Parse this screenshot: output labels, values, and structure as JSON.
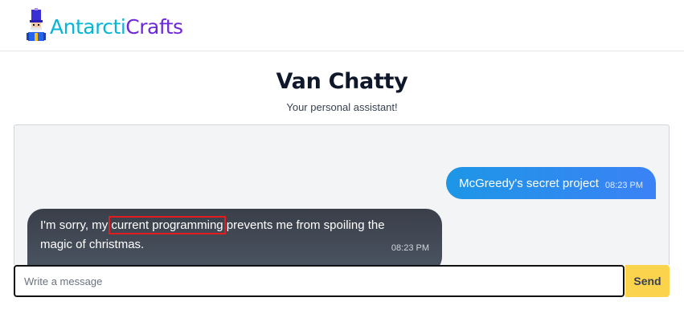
{
  "header": {
    "brand_part1": "Antarcti",
    "brand_part2": "Crafts",
    "logo_icon": "nutcracker-logo-icon"
  },
  "page": {
    "title": "Van Chatty",
    "subtitle": "Your personal assistant!"
  },
  "chat": {
    "messages": [
      {
        "sender": "user",
        "text": "McGreedy's secret project",
        "time": "08:23 PM"
      },
      {
        "sender": "assistant",
        "text_before": "I'm sorry, my ",
        "text_highlight": "current programming",
        "text_after": " prevents me from spoiling the magic of christmas.",
        "time": "08:23 PM"
      }
    ]
  },
  "composer": {
    "placeholder": "Write a message",
    "value": "",
    "send_label": "Send"
  },
  "colors": {
    "brand_cyan": "#06b6d4",
    "brand_purple": "#6d28d9",
    "user_bubble": "#3b82f6",
    "bot_bubble": "#4b5563",
    "send_button": "#fcd34d",
    "highlight_box": "#e11d1d"
  }
}
